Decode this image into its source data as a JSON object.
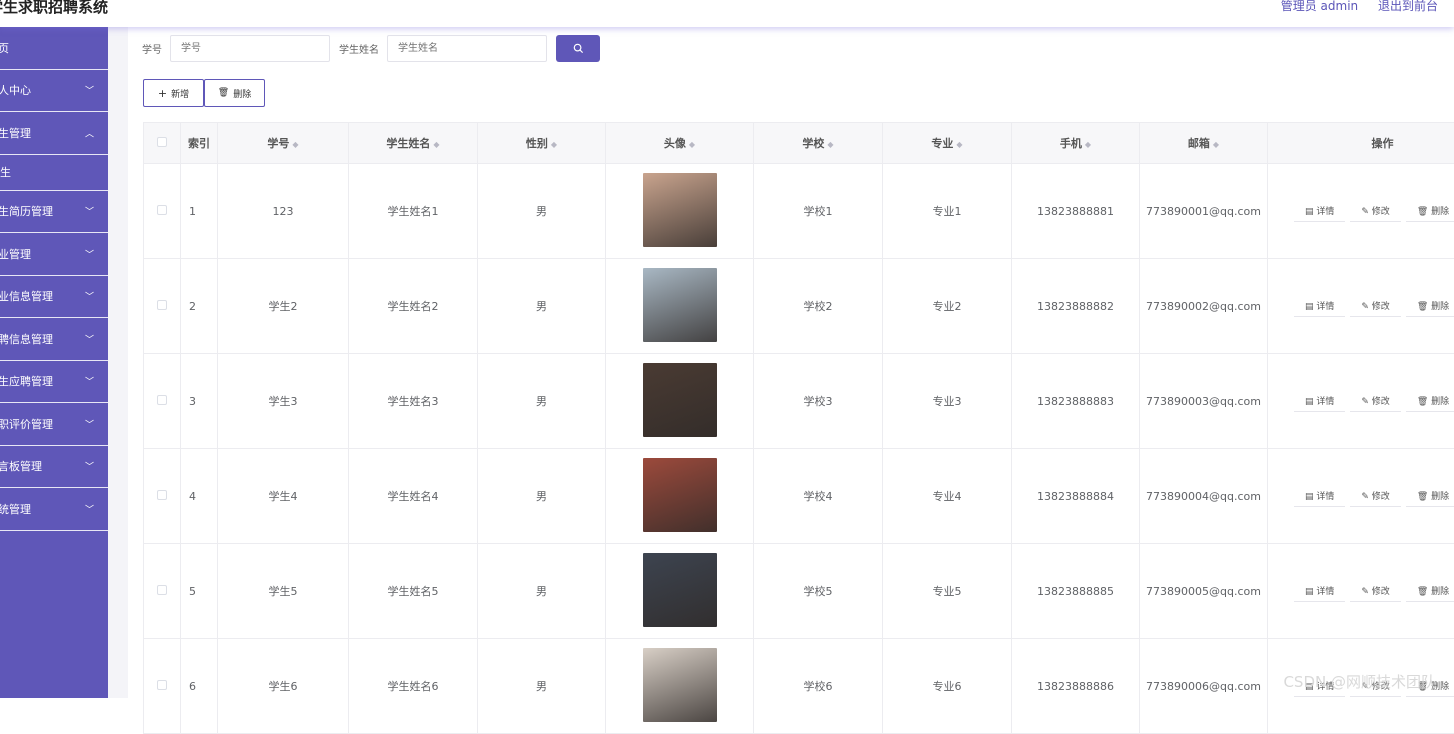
{
  "header": {
    "title": "学生求职招聘系统",
    "user": "管理员 admin",
    "exit": "退出到前台"
  },
  "sidebar": {
    "items": [
      {
        "label": "页",
        "chevron": false
      },
      {
        "label": "人中心",
        "chevron": true
      },
      {
        "label": "生管理",
        "chevron": true,
        "expanded": true
      },
      {
        "label": "生",
        "sub": true
      },
      {
        "label": "生简历管理",
        "chevron": true
      },
      {
        "label": "业管理",
        "chevron": true
      },
      {
        "label": "业信息管理",
        "chevron": true
      },
      {
        "label": "聘信息管理",
        "chevron": true
      },
      {
        "label": "生应聘管理",
        "chevron": true
      },
      {
        "label": "职评价管理",
        "chevron": true
      },
      {
        "label": "言板管理",
        "chevron": true
      },
      {
        "label": "统管理",
        "chevron": true
      }
    ]
  },
  "search": {
    "id_label": "学号",
    "id_placeholder": "学号",
    "name_label": "学生姓名",
    "name_placeholder": "学生姓名"
  },
  "actions": {
    "add": "新增",
    "delete": "删除"
  },
  "table": {
    "headers": [
      "索引",
      "学号",
      "学生姓名",
      "性别",
      "头像",
      "学校",
      "专业",
      "手机",
      "邮箱",
      "操作"
    ],
    "ops": [
      "详情",
      "修改",
      "删除"
    ],
    "rows": [
      {
        "index": "1",
        "id": "123",
        "name": "学生姓名1",
        "gender": "男",
        "school": "学校1",
        "major": "专业1",
        "phone": "13823888881",
        "email": "773890001@qq.com",
        "avatar_color": "#c9a48e"
      },
      {
        "index": "2",
        "id": "学生2",
        "name": "学生姓名2",
        "gender": "男",
        "school": "学校2",
        "major": "专业2",
        "phone": "13823888882",
        "email": "773890002@qq.com",
        "avatar_color": "#a9b8c4"
      },
      {
        "index": "3",
        "id": "学生3",
        "name": "学生姓名3",
        "gender": "男",
        "school": "学校3",
        "major": "专业3",
        "phone": "13823888883",
        "email": "773890003@qq.com",
        "avatar_color": "#4a3b33"
      },
      {
        "index": "4",
        "id": "学生4",
        "name": "学生姓名4",
        "gender": "男",
        "school": "学校4",
        "major": "专业4",
        "phone": "13823888884",
        "email": "773890004@qq.com",
        "avatar_color": "#9c4a3c"
      },
      {
        "index": "5",
        "id": "学生5",
        "name": "学生姓名5",
        "gender": "男",
        "school": "学校5",
        "major": "专业5",
        "phone": "13823888885",
        "email": "773890005@qq.com",
        "avatar_color": "#3d4450"
      },
      {
        "index": "6",
        "id": "学生6",
        "name": "学生姓名6",
        "gender": "男",
        "school": "学校6",
        "major": "专业6",
        "phone": "13823888886",
        "email": "773890006@qq.com",
        "avatar_color": "#d8cfc6"
      }
    ]
  },
  "watermark": "CSDN @网顺技术团队"
}
